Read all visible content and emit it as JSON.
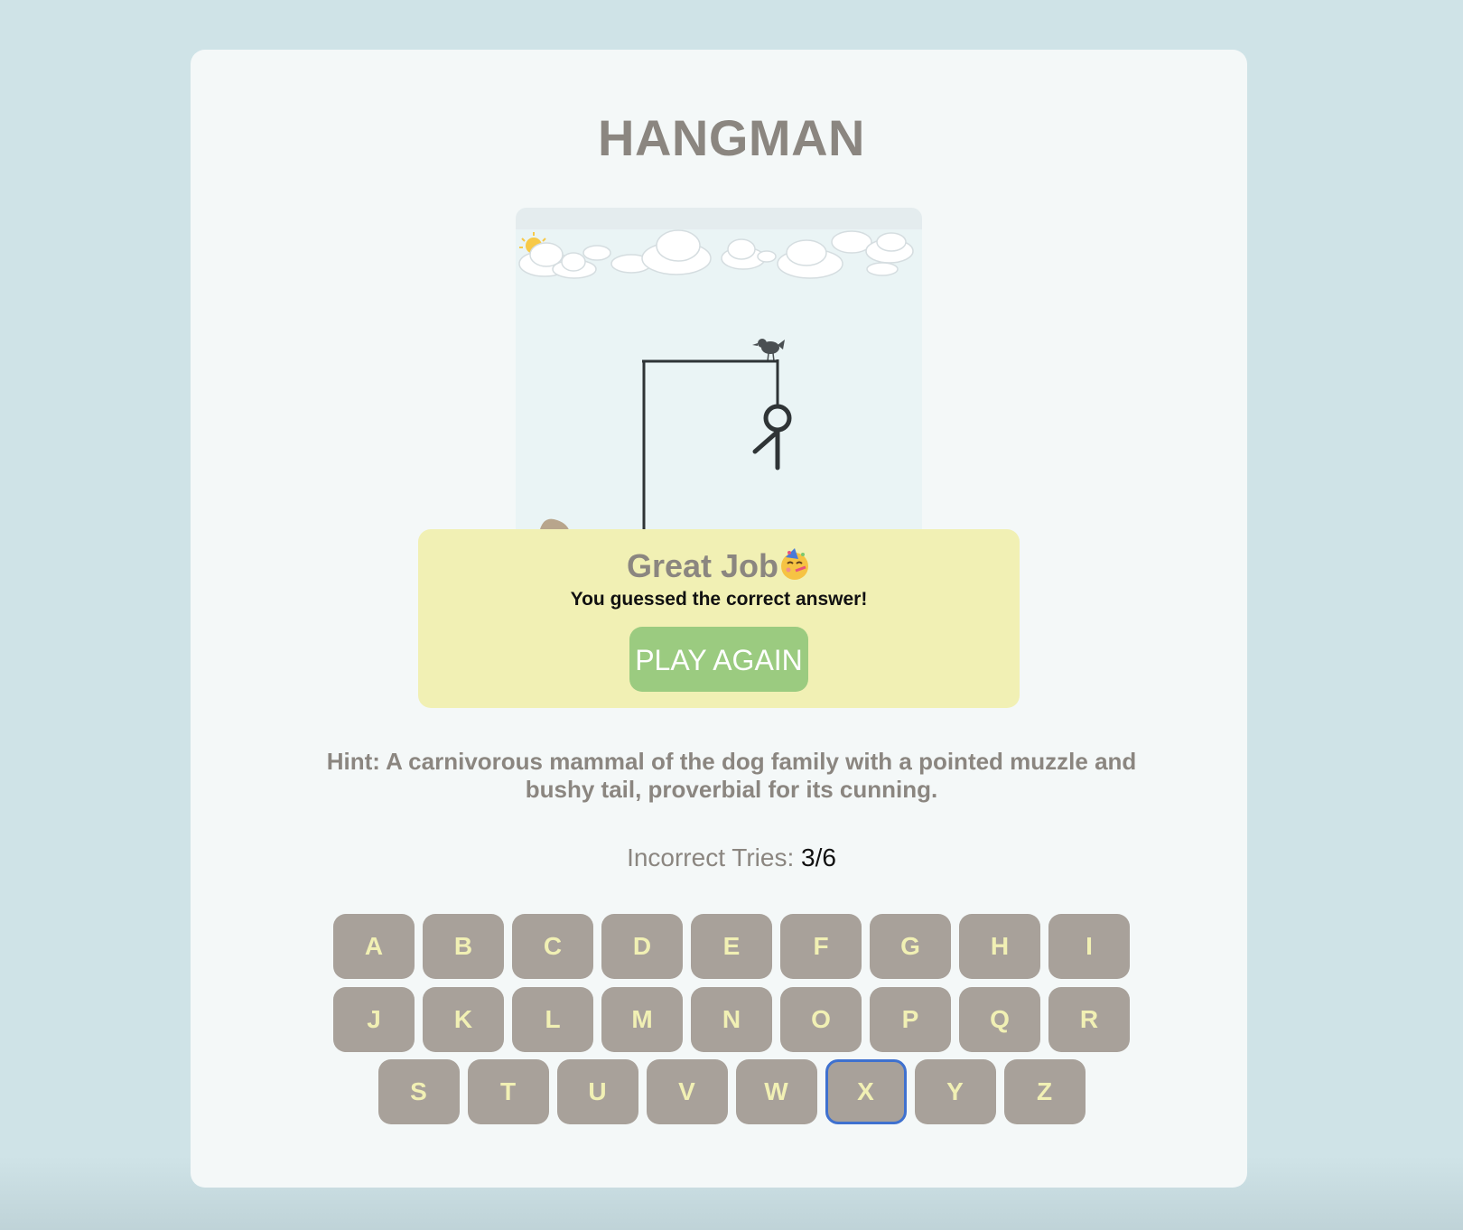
{
  "game": {
    "title": "HANGMAN",
    "hint": "Hint: A carnivorous mammal of the dog family with a pointed muzzle and bushy tail, proverbial for its cunning.",
    "tries_label": "Incorrect Tries: ",
    "tries_value": "3/6",
    "incorrect_tries": 3,
    "max_tries": 6,
    "hangman_parts_shown": [
      "head",
      "body",
      "left-arm"
    ]
  },
  "dialog": {
    "title": "Great Job",
    "emoji": "party-face-icon",
    "message": "You guessed the correct answer!",
    "play_again_label": "PLAY AGAIN"
  },
  "keyboard": {
    "rows": [
      [
        "A",
        "B",
        "C",
        "D",
        "E",
        "F",
        "G",
        "H",
        "I"
      ],
      [
        "J",
        "K",
        "L",
        "M",
        "N",
        "O",
        "P",
        "Q",
        "R"
      ],
      [
        "S",
        "T",
        "U",
        "V",
        "W",
        "X",
        "Y",
        "Z"
      ]
    ],
    "focused_key": "X"
  },
  "scene_icons": [
    "sun-behind-cloud-icon",
    "cloud-icon",
    "bird-icon",
    "gallows-icon",
    "stick-figure-icon",
    "dog-icon"
  ],
  "colors": {
    "background": "#cfe3e7",
    "card": "#f4f8f8",
    "title_text": "#8b8680",
    "dialog_bg": "#f1f0b4",
    "play_button": "#9bcb80",
    "key_bg": "#a8a19a",
    "key_text": "#f1f0b4",
    "focus_ring": "#3f71cf"
  }
}
